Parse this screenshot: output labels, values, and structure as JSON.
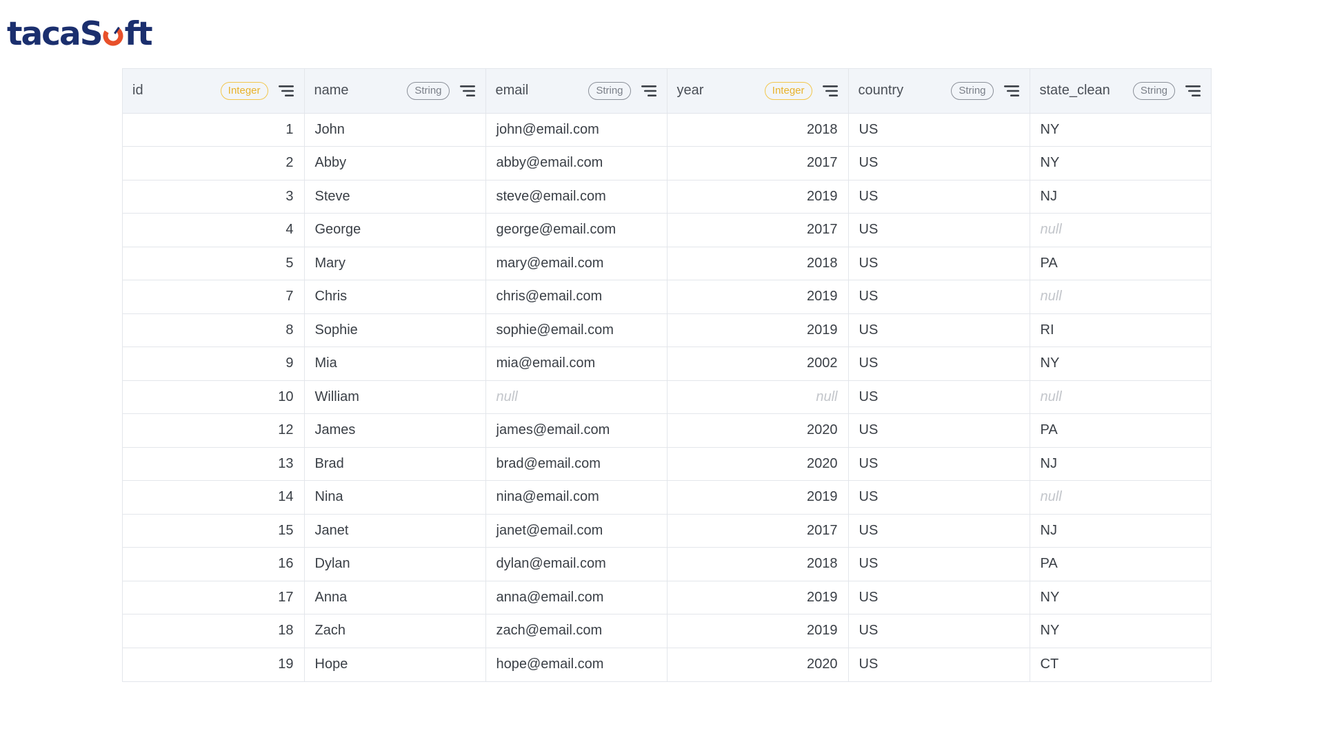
{
  "brand": {
    "name_part1": "taca",
    "name_part2": "S",
    "name_part3": "ft",
    "colors": {
      "primary": "#1b2f6e",
      "accent": "#e8502a"
    }
  },
  "grid": {
    "columns": [
      {
        "label": "id",
        "type": "Integer",
        "align": "right"
      },
      {
        "label": "name",
        "type": "String",
        "align": "left"
      },
      {
        "label": "email",
        "type": "String",
        "align": "left"
      },
      {
        "label": "year",
        "type": "Integer",
        "align": "right"
      },
      {
        "label": "country",
        "type": "String",
        "align": "left"
      },
      {
        "label": "state_clean",
        "type": "String",
        "align": "left"
      }
    ],
    "null_label": "null",
    "rows": [
      [
        "1",
        "John",
        "john@email.com",
        "2018",
        "US",
        "NY"
      ],
      [
        "2",
        "Abby",
        "abby@email.com",
        "2017",
        "US",
        "NY"
      ],
      [
        "3",
        "Steve",
        "steve@email.com",
        "2019",
        "US",
        "NJ"
      ],
      [
        "4",
        "George",
        "george@email.com",
        "2017",
        "US",
        null
      ],
      [
        "5",
        "Mary",
        "mary@email.com",
        "2018",
        "US",
        "PA"
      ],
      [
        "7",
        "Chris",
        "chris@email.com",
        "2019",
        "US",
        null
      ],
      [
        "8",
        "Sophie",
        "sophie@email.com",
        "2019",
        "US",
        "RI"
      ],
      [
        "9",
        "Mia",
        "mia@email.com",
        "2002",
        "US",
        "NY"
      ],
      [
        "10",
        "William",
        null,
        null,
        "US",
        null
      ],
      [
        "12",
        "James",
        "james@email.com",
        "2020",
        "US",
        "PA"
      ],
      [
        "13",
        "Brad",
        "brad@email.com",
        "2020",
        "US",
        "NJ"
      ],
      [
        "14",
        "Nina",
        "nina@email.com",
        "2019",
        "US",
        null
      ],
      [
        "15",
        "Janet",
        "janet@email.com",
        "2017",
        "US",
        "NJ"
      ],
      [
        "16",
        "Dylan",
        "dylan@email.com",
        "2018",
        "US",
        "PA"
      ],
      [
        "17",
        "Anna",
        "anna@email.com",
        "2019",
        "US",
        "NY"
      ],
      [
        "18",
        "Zach",
        "zach@email.com",
        "2019",
        "US",
        "NY"
      ],
      [
        "19",
        "Hope",
        "hope@email.com",
        "2020",
        "US",
        "CT"
      ]
    ]
  }
}
